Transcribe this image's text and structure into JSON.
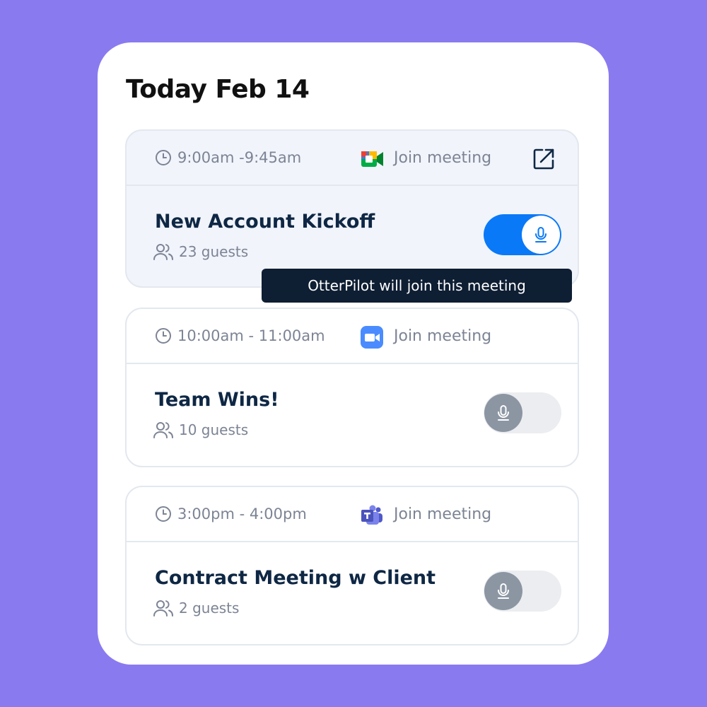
{
  "header": {
    "title": "Today Feb 14"
  },
  "tooltip": {
    "text": "OtterPilot will join this meeting"
  },
  "meetings": [
    {
      "time": "9:00am -9:45am",
      "app": "google-meet-icon",
      "join_label": "Join meeting",
      "title": "New Account Kickoff",
      "guests": "23 guests",
      "otterpilot_enabled": true
    },
    {
      "time": "10:00am - 11:00am",
      "app": "zoom-icon",
      "join_label": "Join meeting",
      "title": "Team Wins!",
      "guests": "10 guests",
      "otterpilot_enabled": false
    },
    {
      "time": "3:00pm - 4:00pm",
      "app": "microsoft-teams-icon",
      "join_label": "Join meeting",
      "title": "Contract Meeting w Client",
      "guests": "2 guests",
      "otterpilot_enabled": false
    }
  ],
  "colors": {
    "background": "#8A7AF0",
    "toggle_on": "#0A79F8",
    "toggle_off_knob": "#8C96A3",
    "title_text": "#0E2744",
    "tooltip_bg": "#0E1E33"
  }
}
